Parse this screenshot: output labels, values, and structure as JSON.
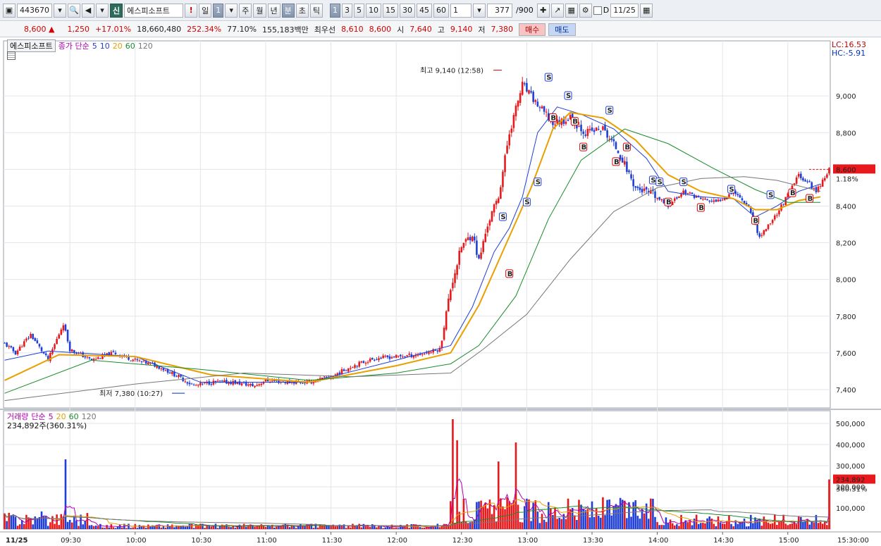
{
  "toolbar": {
    "code": "443670",
    "badge": "신",
    "name": "에스피소프트",
    "excl": "!",
    "period_day": "일",
    "period_val": "1",
    "week": "주",
    "month": "월",
    "year": "년",
    "minute": "분",
    "second": "초",
    "tick": "틱",
    "minute_options": [
      "1",
      "3",
      "5",
      "10",
      "15",
      "30",
      "45",
      "60"
    ],
    "minute_selected": "1",
    "count_input": "1",
    "count_value": "377",
    "count_total": "/900",
    "checkbox_label": "D",
    "date": "11/25"
  },
  "quote": {
    "price": "8,600",
    "arrow": "▲",
    "change": "1,250",
    "change_pct": "+17.01%",
    "volume": "18,660,480",
    "vol_ratio": "252.34%",
    "turnover": "77.10%",
    "amount": "155,183백만",
    "best_label": "최우선",
    "best_ask": "8,610",
    "best_bid": "8,600",
    "open_label": "시",
    "open": "7,640",
    "high_label": "고",
    "high": "9,140",
    "low_label": "저",
    "low": "7,380",
    "buy": "매수",
    "sell": "매도"
  },
  "price_legend": {
    "name": "에스피소프트",
    "type": "종가 단순",
    "ma": [
      "5",
      "10",
      "20",
      "60",
      "120"
    ],
    "lc": "LC:16.53",
    "hc": "HC:-5.91"
  },
  "volume_legend": {
    "name": "거래량",
    "type": "단순",
    "ma": [
      "5",
      "20",
      "60",
      "120"
    ],
    "current": "234,892주(360.31%)"
  },
  "annotations": {
    "high": "최고 9,140 (12:58)",
    "low": "최저 7,380 (10:27)",
    "current_price": "8,600",
    "current_pct": "1.18%",
    "current_volume": "234,892",
    "current_volume_pct": "360.31%"
  },
  "colors": {
    "up": "#e8191c",
    "down": "#1f3fd8",
    "ma5": "#1f3fd8",
    "ma10": "#1f3fd8",
    "ma20": "#e8a000",
    "ma60": "#1a8c2a",
    "ma120": "#777777",
    "vma5": "#b000b0",
    "vma20": "#e8a000",
    "vma60": "#1a8c2a",
    "vma120": "#777777"
  },
  "chart_data": {
    "type": "candlestick",
    "x_date": "11/25",
    "x_ticks": [
      "09:30",
      "10:00",
      "10:30",
      "11:00",
      "11:30",
      "12:00",
      "12:30",
      "13:00",
      "13:30",
      "14:00",
      "14:30",
      "15:00",
      "15:30:00"
    ],
    "price_axis": {
      "ylim": [
        7300,
        9300
      ],
      "ticks": [
        "7,400",
        "7,600",
        "7,800",
        "8,000",
        "8,200",
        "8,400",
        "8,600",
        "8,800",
        "9,000"
      ],
      "values": [
        7400,
        7600,
        7800,
        8000,
        8200,
        8400,
        8600,
        8800,
        9000
      ]
    },
    "volume_axis": {
      "ylim": [
        0,
        560000
      ],
      "ticks": [
        "100,000",
        "200,000",
        "300,000",
        "400,000",
        "500,000"
      ],
      "values": [
        100000,
        200000,
        300000,
        400000,
        500000
      ]
    },
    "price_path": [
      [
        "09:00",
        7650
      ],
      [
        "09:05",
        7600
      ],
      [
        "09:12",
        7700
      ],
      [
        "09:20",
        7560
      ],
      [
        "09:27",
        7760
      ],
      [
        "09:30",
        7620
      ],
      [
        "09:40",
        7560
      ],
      [
        "09:50",
        7600
      ],
      [
        "10:00",
        7560
      ],
      [
        "10:10",
        7530
      ],
      [
        "10:20",
        7470
      ],
      [
        "10:27",
        7420
      ],
      [
        "10:35",
        7440
      ],
      [
        "10:45",
        7440
      ],
      [
        "10:55",
        7420
      ],
      [
        "11:00",
        7450
      ],
      [
        "11:10",
        7440
      ],
      [
        "11:20",
        7440
      ],
      [
        "11:30",
        7470
      ],
      [
        "11:40",
        7530
      ],
      [
        "11:50",
        7570
      ],
      [
        "12:00",
        7580
      ],
      [
        "12:10",
        7590
      ],
      [
        "12:20",
        7620
      ],
      [
        "12:25",
        7950
      ],
      [
        "12:30",
        8180
      ],
      [
        "12:35",
        8250
      ],
      [
        "12:38",
        8100
      ],
      [
        "12:42",
        8300
      ],
      [
        "12:47",
        8450
      ],
      [
        "12:52",
        8800
      ],
      [
        "12:58",
        9060
      ],
      [
        "13:05",
        8950
      ],
      [
        "13:12",
        8850
      ],
      [
        "13:20",
        8880
      ],
      [
        "13:27",
        8800
      ],
      [
        "13:35",
        8820
      ],
      [
        "13:42",
        8700
      ],
      [
        "13:50",
        8500
      ],
      [
        "13:58",
        8460
      ],
      [
        "14:05",
        8400
      ],
      [
        "14:12",
        8480
      ],
      [
        "14:20",
        8440
      ],
      [
        "14:27",
        8420
      ],
      [
        "14:35",
        8480
      ],
      [
        "14:42",
        8400
      ],
      [
        "14:47",
        8230
      ],
      [
        "14:55",
        8360
      ],
      [
        "15:00",
        8460
      ],
      [
        "15:05",
        8570
      ],
      [
        "15:10",
        8520
      ],
      [
        "15:13",
        8480
      ],
      [
        "15:19",
        8600
      ]
    ],
    "series": [
      {
        "name": "5",
        "values": [
          [
            0,
            7560
          ],
          [
            20,
            7610
          ],
          [
            60,
            7580
          ],
          [
            90,
            7440
          ],
          [
            140,
            7440
          ],
          [
            180,
            7560
          ],
          [
            205,
            7640
          ],
          [
            215,
            7850
          ],
          [
            225,
            8150
          ],
          [
            232,
            8280
          ],
          [
            238,
            8450
          ],
          [
            245,
            8800
          ],
          [
            254,
            8940
          ],
          [
            265,
            8900
          ],
          [
            280,
            8820
          ],
          [
            295,
            8660
          ],
          [
            305,
            8480
          ],
          [
            320,
            8450
          ],
          [
            335,
            8440
          ],
          [
            345,
            8340
          ],
          [
            355,
            8400
          ],
          [
            365,
            8480
          ],
          [
            375,
            8520
          ]
        ]
      },
      {
        "name": "20",
        "values": [
          [
            0,
            7450
          ],
          [
            25,
            7590
          ],
          [
            60,
            7580
          ],
          [
            95,
            7480
          ],
          [
            140,
            7440
          ],
          [
            180,
            7530
          ],
          [
            205,
            7600
          ],
          [
            218,
            7860
          ],
          [
            230,
            8180
          ],
          [
            242,
            8500
          ],
          [
            252,
            8820
          ],
          [
            260,
            8910
          ],
          [
            275,
            8880
          ],
          [
            290,
            8760
          ],
          [
            305,
            8570
          ],
          [
            320,
            8480
          ],
          [
            335,
            8440
          ],
          [
            345,
            8380
          ],
          [
            355,
            8380
          ],
          [
            365,
            8430
          ],
          [
            375,
            8450
          ]
        ]
      },
      {
        "name": "60",
        "values": [
          [
            0,
            7380
          ],
          [
            40,
            7560
          ],
          [
            90,
            7510
          ],
          [
            140,
            7450
          ],
          [
            180,
            7490
          ],
          [
            205,
            7540
          ],
          [
            218,
            7640
          ],
          [
            235,
            7910
          ],
          [
            250,
            8330
          ],
          [
            265,
            8650
          ],
          [
            285,
            8820
          ],
          [
            305,
            8740
          ],
          [
            325,
            8610
          ],
          [
            345,
            8490
          ],
          [
            360,
            8420
          ],
          [
            375,
            8420
          ]
        ]
      },
      {
        "name": "120",
        "values": [
          [
            0,
            7340
          ],
          [
            60,
            7430
          ],
          [
            110,
            7490
          ],
          [
            160,
            7470
          ],
          [
            205,
            7490
          ],
          [
            220,
            7620
          ],
          [
            240,
            7810
          ],
          [
            260,
            8110
          ],
          [
            280,
            8370
          ],
          [
            300,
            8500
          ],
          [
            320,
            8550
          ],
          [
            340,
            8560
          ],
          [
            355,
            8540
          ],
          [
            375,
            8480
          ]
        ]
      }
    ],
    "volume_spikes": [
      {
        "time": "09:28",
        "value": 330000
      },
      {
        "time": "12:26",
        "value": 520000
      },
      {
        "time": "12:28",
        "value": 420000
      },
      {
        "time": "12:47",
        "value": 320000
      },
      {
        "time": "12:55",
        "value": 410000
      },
      {
        "time": "15:19",
        "value": 234892
      }
    ]
  }
}
